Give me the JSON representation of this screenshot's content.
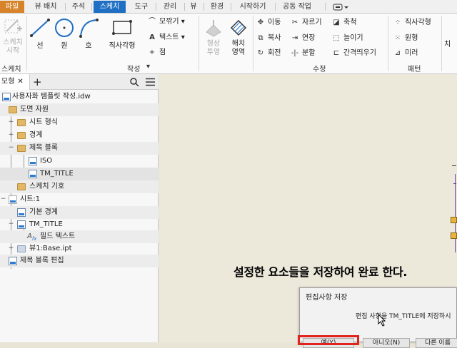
{
  "ribbon_tabs": [
    {
      "label": "파일",
      "style": "file"
    },
    {
      "label": "뷰 배치",
      "style": ""
    },
    {
      "label": "주석",
      "style": ""
    },
    {
      "label": "스케치",
      "style": "active"
    },
    {
      "label": "도구",
      "style": ""
    },
    {
      "label": "관리",
      "style": ""
    },
    {
      "label": "뷰",
      "style": ""
    },
    {
      "label": "환경",
      "style": ""
    },
    {
      "label": "시작하기",
      "style": ""
    },
    {
      "label": "공동 작업",
      "style": ""
    }
  ],
  "ribbon": {
    "sketch_start": {
      "line1": "스케치",
      "line2": "시작"
    },
    "line": "선",
    "circle": "원",
    "arc": "호",
    "rectangle": "직사각형",
    "fillet": "모깎기",
    "text": "텍스트",
    "point": "점",
    "project": {
      "line1": "형상",
      "line2": "투영"
    },
    "hatch": {
      "line1": "해치",
      "line2": "영역"
    },
    "move": "이동",
    "copy": "복사",
    "rotate": "회전",
    "trim": "자르기",
    "extend": "연장",
    "split": "분할",
    "scale": "축척",
    "stretch": "늘이기",
    "offset": "간격띄우기",
    "rect_pattern": "직사각형",
    "circ_pattern": "원형",
    "mirror": "미러",
    "cut_right": "치",
    "panels": {
      "sketch": "스케치",
      "create": "작성",
      "modify": "수정",
      "pattern": "패턴"
    }
  },
  "browser": {
    "tab_label": "모형",
    "tree": [
      {
        "label": "사용자화 템플릿 작성.idw",
        "icon": "doc"
      },
      {
        "label": "도면 자원",
        "icon": "folder"
      },
      {
        "label": "시트 형식",
        "icon": "folder"
      },
      {
        "label": "경계",
        "icon": "folder"
      },
      {
        "label": "제목 블록",
        "icon": "folder"
      },
      {
        "label": "ISO",
        "icon": "doc"
      },
      {
        "label": "TM_TITLE",
        "icon": "doc"
      },
      {
        "label": "스케치 기호",
        "icon": "folder"
      },
      {
        "label": "시트:1",
        "icon": "sheet"
      },
      {
        "label": "기본 경계",
        "icon": "border"
      },
      {
        "label": "TM_TITLE",
        "icon": "doc"
      },
      {
        "label": "필드 텍스트",
        "icon": "text"
      },
      {
        "label": "뷰1:Base.ipt",
        "icon": "view"
      },
      {
        "label": "제목 블록 편집",
        "icon": "doc"
      }
    ]
  },
  "caption": "설정한 요소들을 저장하여 완료 한다.",
  "dialog": {
    "title": "편집사항 저장",
    "message": "편집 사항을 TM_TITLE에 저장하시",
    "yes": "예(Y)",
    "no": "아니오(N)",
    "cancel": "다른 이름"
  },
  "colors": {
    "file_tab": "#d7832a",
    "active_tab": "#1f6fc4",
    "highlight": "#e0231d",
    "canvas": "#ece8da"
  }
}
